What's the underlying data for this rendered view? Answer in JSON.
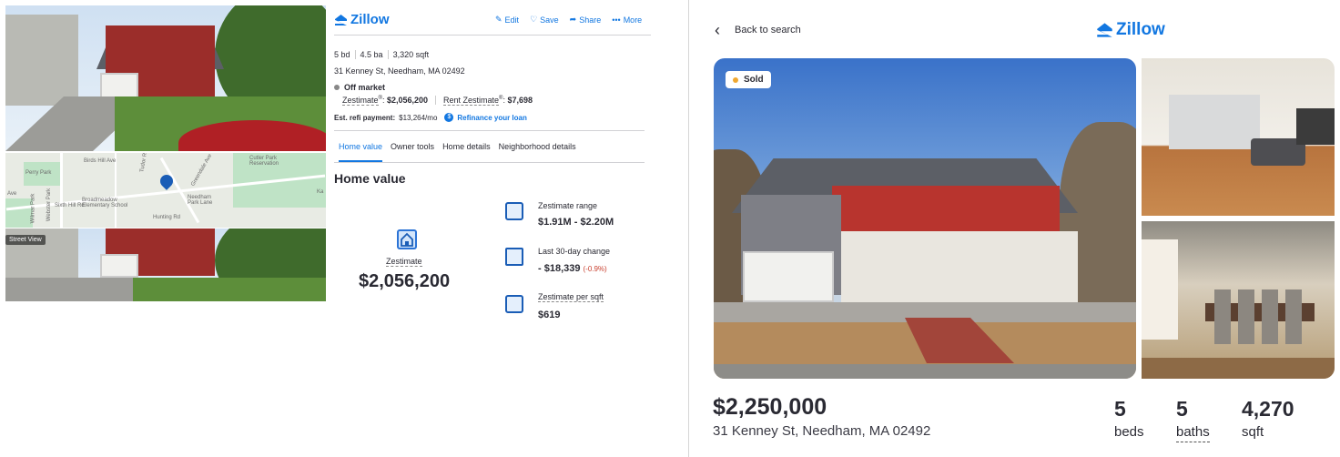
{
  "left": {
    "street_view_label": "Street View",
    "map_labels": [
      "Perry Park",
      "Cutler Park Reservation",
      "Broadmeadow Elementary School",
      "Needham Park Lane",
      "Greendale Ave",
      "Webster Park",
      "Sixth Hill Rd",
      "Wilmar Park",
      "Ave",
      "Birds Hill Ave",
      "Tudor Rd",
      "Hunting Rd",
      "Ka"
    ]
  },
  "panel": {
    "logo": "Zillow",
    "actions": {
      "edit": "Edit",
      "save": "Save",
      "share": "Share",
      "more": "More"
    },
    "facts": [
      "5 bd",
      "4.5 ba",
      "3,320 sqft"
    ],
    "address": "31 Kenney St, Needham, MA 02492",
    "status": "Off market",
    "zestimate_label": "Zestimate",
    "zestimate_value": "$2,056,200",
    "rent_label": "Rent Zestimate",
    "rent_value": "$7,698",
    "refi_label": "Est. refi payment:",
    "refi_value": "$13,264/mo",
    "refi_link": "Refinance your loan",
    "tabs": [
      "Home value",
      "Owner tools",
      "Home details",
      "Neighborhood details"
    ],
    "section_title": "Home value",
    "big_label": "Zestimate",
    "big_value": "$2,056,200",
    "stats": [
      {
        "label": "Zestimate range",
        "value": "$1.91M - $2.20M"
      },
      {
        "label": "Last 30-day change",
        "value": "- $18,339",
        "change": "(-0.9%)"
      },
      {
        "label": "Zestimate per sqft",
        "value": "$619"
      }
    ]
  },
  "right": {
    "back": "Back to search",
    "logo": "Zillow",
    "sold": "Sold",
    "price": "$2,250,000",
    "address": "31 Kenney St, Needham, MA 02492",
    "beds": "5",
    "beds_label": "beds",
    "baths": "5",
    "baths_label": "baths",
    "sqft": "4,270",
    "sqft_label": "sqft"
  },
  "colors": {
    "accent": "#1277e1",
    "negative": "#c9402f",
    "sold_dot": "#f0a830"
  }
}
